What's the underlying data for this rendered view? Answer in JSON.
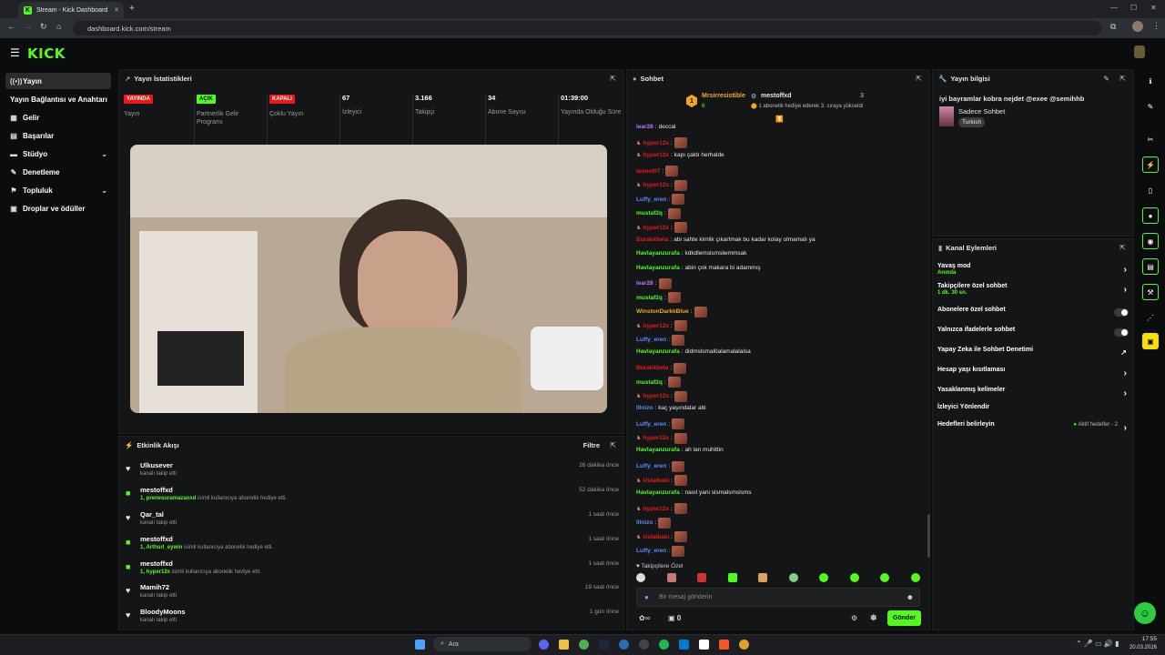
{
  "browser": {
    "tab_title": "Stream - Kick Dashboard",
    "url": "dashboard.kick.com/stream"
  },
  "app": {
    "logo": "KICK"
  },
  "sidebar": {
    "items": [
      {
        "label": "Yayın",
        "icon": "broadcast-icon",
        "active": true
      },
      {
        "label": "Yayın Bağlantısı ve Anahtarı",
        "icon": ""
      },
      {
        "label": "Gelir",
        "icon": "revenue-icon"
      },
      {
        "label": "Başarılar",
        "icon": "achievements-icon"
      },
      {
        "label": "Stüdyo",
        "icon": "studio-icon",
        "expandable": true
      },
      {
        "label": "Denetleme",
        "icon": "moderation-icon"
      },
      {
        "label": "Topluluk",
        "icon": "community-icon",
        "expandable": true
      },
      {
        "label": "Droplar ve ödüller",
        "icon": "drops-icon"
      }
    ]
  },
  "stats": {
    "title": "Yayın İstatistikleri",
    "items": [
      {
        "badge": "YAYINDA",
        "badge_color": "#e91916",
        "label": "Yayın"
      },
      {
        "badge": "AÇIK",
        "badge_color": "#53fc18",
        "label": "Partnerlik Gelir Programı"
      },
      {
        "badge": "KAPALI",
        "badge_color": "#e91916",
        "label": "Çoklu Yayın"
      },
      {
        "value": "67",
        "label": "İzleyici"
      },
      {
        "value": "3.166",
        "label": "Takipçi"
      },
      {
        "value": "34",
        "label": "Abone Sayısı"
      },
      {
        "value": "01:39:00",
        "label": "Yayında Olduğu Süre"
      }
    ]
  },
  "activity": {
    "title": "Etkinlik Akışı",
    "filter": "Filtre",
    "items": [
      {
        "name": "Ulkusever",
        "sub": "kanalı takip etti",
        "time": "26 dakika önce",
        "type": "follow"
      },
      {
        "name": "mestoffxd",
        "sub_highlight": "1, prenesuramazanxd",
        "sub": " isimli kullanıcıya abonelik hediye etti.",
        "time": "52 dakika önce",
        "type": "gift"
      },
      {
        "name": "Qar_tal",
        "sub": "kanalı takip etti",
        "time": "1 saat önce",
        "type": "follow"
      },
      {
        "name": "mestoffxd",
        "sub_highlight": "1, Arthurl_eywin",
        "sub": " isimli kullanıcıya abonelik hediye etti.",
        "time": "1 saat önce",
        "type": "gift"
      },
      {
        "name": "mestoffxd",
        "sub_highlight": "1, hyper12x",
        "sub": " isimli kullanıcıya abonelik hediye etti.",
        "time": "1 saat önce",
        "type": "gift"
      },
      {
        "name": "Mamih72",
        "sub": "kanalı takip etti",
        "time": "19 saat önce",
        "type": "follow"
      },
      {
        "name": "BloodyMoons",
        "sub": "kanalı takip etti",
        "time": "1 gün önce",
        "type": "follow"
      }
    ]
  },
  "chat": {
    "title": "Sohbet",
    "pinned": {
      "leader": "Mrsirresistible",
      "leader_count": "6",
      "rank_num": "1",
      "gifter": "mestoffxd",
      "gift_count": "3",
      "gift_text": "1 abonelik hediye ederek 3. sıraya yükseldi"
    },
    "messages": [
      {
        "user": "lear28",
        "color": "#b57cff",
        "text": "deccal"
      },
      {
        "user": "hyper12x",
        "color": "#e91916",
        "text": "",
        "emote": true,
        "icon": true
      },
      {
        "user": "hyper12x",
        "color": "#e91916",
        "text": "kapı çaldı herhalde",
        "icon": true
      },
      {
        "user": "leonet07",
        "color": "#e91916",
        "text": "",
        "emote": true
      },
      {
        "user": "hyper12x",
        "color": "#e91916",
        "text": "",
        "emote": true,
        "icon": true
      },
      {
        "user": "Luffy_eren",
        "color": "#5b8cff",
        "text": "",
        "emote": true
      },
      {
        "user": "mustaf2q",
        "color": "#53fc18",
        "text": "",
        "emote": true
      },
      {
        "user": "hyper12x",
        "color": "#e91916",
        "text": "",
        "emote": true,
        "icon": true
      },
      {
        "user": "Burakkbeta",
        "color": "#e91916",
        "text": "abi sahte kimlik çıkartmak bu kadar kolay olmamalı ya"
      },
      {
        "user": "Havlayanzurafa",
        "color": "#53fc18",
        "text": "kdkdlemslsmslwmmsak"
      },
      {
        "user": "Havlayanzurafa",
        "color": "#53fc18",
        "text": "abin çok makara bi adammış"
      },
      {
        "user": "lear28",
        "color": "#b57cff",
        "text": "",
        "emote": true
      },
      {
        "user": "mustaf2q",
        "color": "#53fc18",
        "text": "",
        "emote": true
      },
      {
        "user": "WinstonDarkkBlue",
        "color": "#f5a623",
        "text": "",
        "emote": true
      },
      {
        "user": "hyper12x",
        "color": "#e91916",
        "text": "",
        "emote": true,
        "icon": true
      },
      {
        "user": "Luffy_eren",
        "color": "#5b8cff",
        "text": "",
        "emote": true
      },
      {
        "user": "Havlayanzurafa",
        "color": "#53fc18",
        "text": "didmslsmalöalamalalalsa"
      },
      {
        "user": "Burakkbeta",
        "color": "#e91916",
        "text": "",
        "emote": true
      },
      {
        "user": "mustaf2q",
        "color": "#53fc18",
        "text": "",
        "emote": true
      },
      {
        "user": "hyper12x",
        "color": "#e91916",
        "text": "",
        "emote": true,
        "icon": true
      },
      {
        "user": "lllnizo",
        "color": "#5b8cff",
        "text": "kaç yaşındalar abi"
      },
      {
        "user": "Luffy_eren",
        "color": "#5b8cff",
        "text": "",
        "emote": true
      },
      {
        "user": "hyper12x",
        "color": "#e91916",
        "text": "",
        "emote": true,
        "icon": true
      },
      {
        "user": "Havlayanzurafa",
        "color": "#53fc18",
        "text": "ah lan muhittin"
      },
      {
        "user": "Luffy_eren",
        "color": "#5b8cff",
        "text": "",
        "emote": true
      },
      {
        "user": "Ustalbaki",
        "color": "#e91916",
        "text": "",
        "emote": true,
        "icon": true
      },
      {
        "user": "Havlayanzurafa",
        "color": "#53fc18",
        "text": "nasıl yani slsmalsmslsms"
      },
      {
        "user": "hyper12x",
        "color": "#e91916",
        "text": "",
        "emote": true,
        "icon": true
      },
      {
        "user": "lllnizo",
        "color": "#5b8cff",
        "text": "",
        "emote": true
      },
      {
        "user": "Ustalbaki",
        "color": "#e91916",
        "text": "",
        "emote": true,
        "icon": true
      },
      {
        "user": "Luffy_eren",
        "color": "#5b8cff",
        "text": "",
        "emote": true
      }
    ],
    "followers_only": "Takipçilere Özel",
    "input_placeholder": "Bir mesaj gönderin",
    "infinity": "∞",
    "count": "0",
    "send_label": "Gönder"
  },
  "stream_info": {
    "title": "Yayın bilgisi",
    "stream_title": "iyi bayramlar kobra nejdet @exee @semihhb",
    "category": "Sadece Sohbet",
    "tag": "Turkish"
  },
  "channel_actions": {
    "title": "Kanal Eylemleri",
    "items": [
      {
        "label": "Yavaş mod",
        "sub": "Anında",
        "control": "arrow"
      },
      {
        "label": "Takipçilere özel sohbet",
        "sub": "1 dk. 30 sn.",
        "control": "arrow"
      },
      {
        "label": "Abonelere özel sohbet",
        "control": "toggle"
      },
      {
        "label": "Yalnızca ifadelerle sohbet",
        "control": "toggle"
      },
      {
        "label": "Yapay Zeka ile Sohbet Denetimi",
        "control": "external"
      },
      {
        "label": "Hesap yaşı kısıtlaması",
        "control": "arrow"
      },
      {
        "label": "Yasaklanmış kelimeler",
        "control": "arrow"
      },
      {
        "label": "İzleyici Yönlendir",
        "control": "none"
      },
      {
        "label": "Hedefleri belirleyin",
        "status": "Aktif hedefler - 2",
        "control": "arrow"
      }
    ]
  },
  "taskbar": {
    "search": "Ara",
    "time": "17:55",
    "date": "20.03.2026"
  },
  "colors": {
    "accent": "#53fc18",
    "live": "#e91916",
    "bg": "#0b0c0d",
    "panel": "#141517"
  }
}
